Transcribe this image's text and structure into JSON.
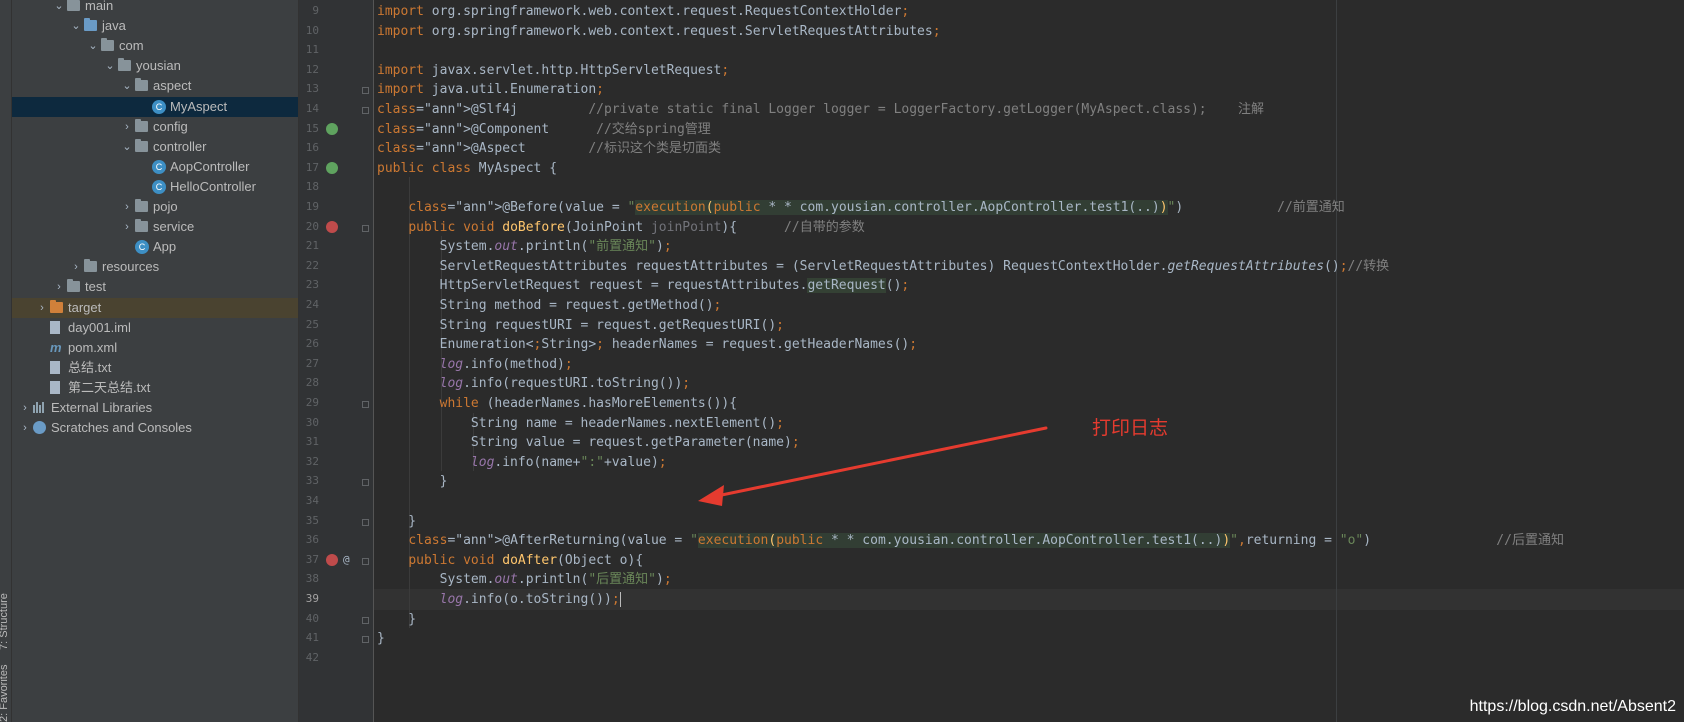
{
  "sidebar": {
    "structure_tab": "7: Structure",
    "favorites_tab": "2: Favorites"
  },
  "project_tree": [
    {
      "label": "main",
      "indent": 3,
      "expanded": true,
      "icon": "folder"
    },
    {
      "label": "java",
      "indent": 4,
      "expanded": true,
      "icon": "folder-blue"
    },
    {
      "label": "com",
      "indent": 5,
      "expanded": true,
      "icon": "folder"
    },
    {
      "label": "yousian",
      "indent": 6,
      "expanded": true,
      "icon": "folder"
    },
    {
      "label": "aspect",
      "indent": 7,
      "expanded": true,
      "icon": "folder"
    },
    {
      "label": "MyAspect",
      "indent": 8,
      "icon": "class",
      "selected": true
    },
    {
      "label": "config",
      "indent": 7,
      "expanded": false,
      "icon": "folder"
    },
    {
      "label": "controller",
      "indent": 7,
      "expanded": true,
      "icon": "folder"
    },
    {
      "label": "AopController",
      "indent": 8,
      "icon": "class"
    },
    {
      "label": "HelloController",
      "indent": 8,
      "icon": "class"
    },
    {
      "label": "pojo",
      "indent": 7,
      "expanded": false,
      "icon": "folder"
    },
    {
      "label": "service",
      "indent": 7,
      "expanded": false,
      "icon": "folder"
    },
    {
      "label": "App",
      "indent": 7,
      "icon": "class"
    },
    {
      "label": "resources",
      "indent": 4,
      "expanded": false,
      "icon": "folder-res"
    },
    {
      "label": "test",
      "indent": 3,
      "expanded": false,
      "icon": "folder"
    },
    {
      "label": "target",
      "indent": 2,
      "expanded": false,
      "icon": "folder-orange",
      "highlight": true
    },
    {
      "label": "day001.iml",
      "indent": 2,
      "icon": "file"
    },
    {
      "label": "pom.xml",
      "indent": 2,
      "icon": "maven"
    },
    {
      "label": "总结.txt",
      "indent": 2,
      "icon": "file"
    },
    {
      "label": "第二天总结.txt",
      "indent": 2,
      "icon": "file"
    },
    {
      "label": "External Libraries",
      "indent": 1,
      "expanded": false,
      "icon": "libs"
    },
    {
      "label": "Scratches and Consoles",
      "indent": 1,
      "expanded": false,
      "icon": "scratch"
    }
  ],
  "editor": {
    "line_numbers": [
      "9",
      "10",
      "11",
      "12",
      "13",
      "14",
      "15",
      "16",
      "17",
      "18",
      "19",
      "20",
      "21",
      "22",
      "23",
      "24",
      "25",
      "26",
      "27",
      "28",
      "29",
      "30",
      "31",
      "32",
      "33",
      "34",
      "35",
      "36",
      "37",
      "38",
      "39",
      "40",
      "41",
      "42"
    ],
    "current_line": "39",
    "code_lines": [
      "import org.springframework.web.context.request.RequestContextHolder;",
      "import org.springframework.web.context.request.ServletRequestAttributes;",
      "",
      "import javax.servlet.http.HttpServletRequest;",
      "import java.util.Enumeration;",
      "@Slf4j         //private static final Logger logger = LoggerFactory.getLogger(MyAspect.class);    注解",
      "@Component      //交给spring管理",
      "@Aspect        //标识这个类是切面类",
      "public class MyAspect {",
      "",
      "    @Before(value = \"execution(public * com.yousian.controller.AopController.test1(..))\")            //前置通知",
      "    public void doBefore(JoinPoint joinPoint){      //自带的参数",
      "        System.out.println(\"前置通知\");",
      "        ServletRequestAttributes requestAttributes = (ServletRequestAttributes) RequestContextHolder.getRequestAttributes();//转换",
      "        HttpServletRequest request = requestAttributes.getRequest();",
      "        String method = request.getMethod();",
      "        String requestURI = request.getRequestURI();",
      "        Enumeration<String> headerNames = request.getHeaderNames();",
      "        log.info(method);",
      "        log.info(requestURI.toString());",
      "        while (headerNames.hasMoreElements()){",
      "            String name = headerNames.nextElement();",
      "            String value = request.getParameter(name);",
      "            log.info(name+\":\"+value);",
      "        }",
      "",
      "    }",
      "    @AfterReturning(value = \"execution(public * com.yousian.controller.AopController.test1(..))\",returning = \"o\")                //后置通知",
      "    public void doAfter(Object o){",
      "        System.out.println(\"后置通知\");",
      "        log.info(o.toString());",
      "    }",
      "}",
      ""
    ]
  },
  "annotation": {
    "label": "打印日志",
    "color": "#e53b2f"
  },
  "watermark": "https://blog.csdn.net/Absent2",
  "colors": {
    "keyword": "#cc7832",
    "string": "#6a8759",
    "annotation": "#bbb529",
    "comment": "#808080",
    "method": "#ffc66d",
    "field": "#9876aa",
    "text": "#a9b7c6",
    "selection": "#0d293e"
  }
}
